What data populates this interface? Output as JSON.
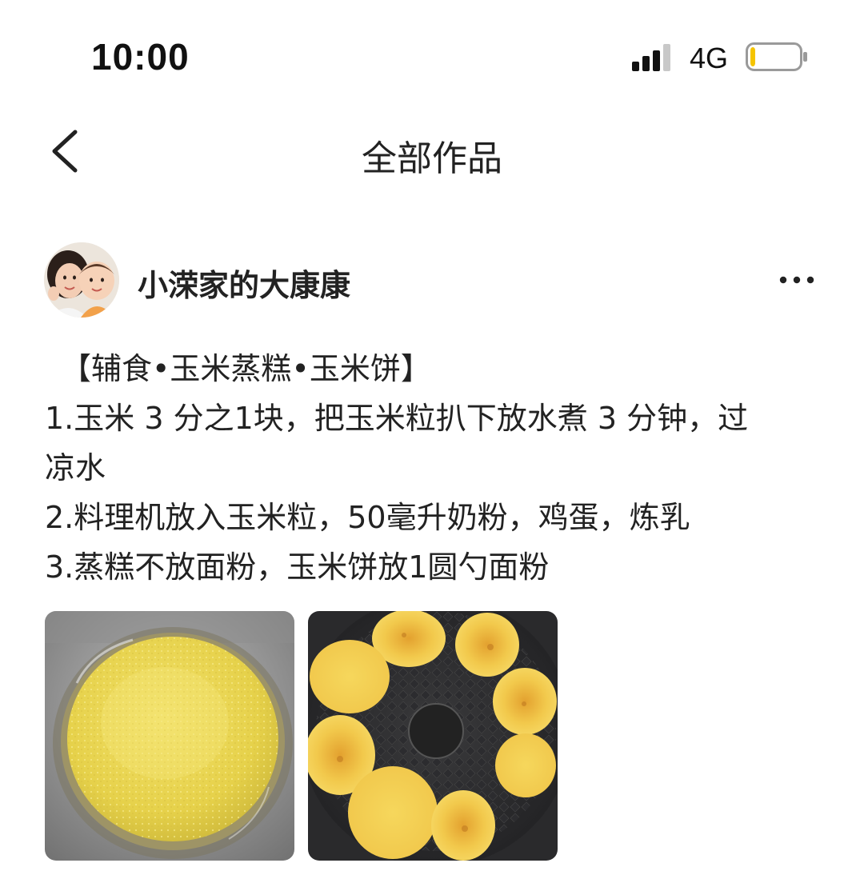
{
  "status_bar": {
    "time": "10:00",
    "network": "4G",
    "signal_icon": "signal-bars-icon",
    "battery_icon": "battery-low-icon",
    "battery_level": 0.1,
    "battery_color": "#f5c400"
  },
  "nav": {
    "back_icon": "chevron-left-icon",
    "title": "全部作品"
  },
  "author": {
    "name": "小溁家的大康康",
    "avatar_icon": "avatar-mother-and-baby",
    "more_icon": "more-dots-icon"
  },
  "post": {
    "lines": [
      "【辅食•玉米蒸糕•玉米饼】",
      "1.玉米 3 分之1块，把玉米粒扒下放水煮 3 分钟，过",
      "凉水",
      "2.料理机放入玉米粒，50毫升奶粉，鸡蛋，炼乳",
      "3.蒸糕不放面粉，玉米饼放1圆勺面粉"
    ],
    "images": [
      {
        "icon": "steamed-corn-cake-photo",
        "alt_color": "#e8d44d"
      },
      {
        "icon": "corn-pancakes-in-pan-photo",
        "alt_color": "#f1c84a"
      }
    ]
  },
  "colors": {
    "text": "#222222",
    "background": "#ffffff",
    "corn_yellow": "#e9d548"
  }
}
